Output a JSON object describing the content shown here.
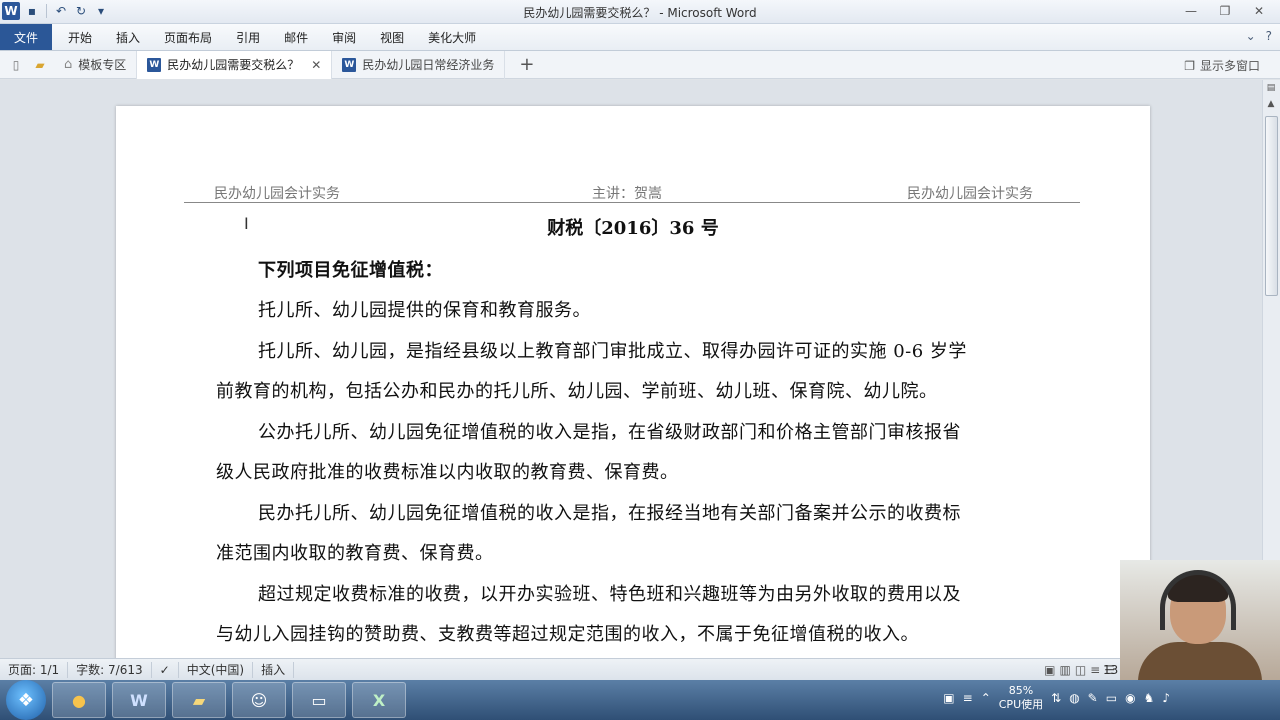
{
  "window": {
    "title": "民办幼儿园需要交税么？ - Microsoft Word",
    "controls": [
      "—",
      "❐",
      "✕"
    ]
  },
  "quick_access": {
    "logo": "W",
    "icons": [
      "save-icon",
      "undo-icon",
      "redo-icon",
      "customize-icon"
    ]
  },
  "ribbon": {
    "tabs": [
      "文件",
      "开始",
      "插入",
      "页面布局",
      "引用",
      "邮件",
      "审阅",
      "视图",
      "美化大师"
    ],
    "right_icons": [
      "chevron-down-icon",
      "help-icon"
    ]
  },
  "doc_tabs": {
    "home_label": "模板专区",
    "tabs": [
      "民办幼儿园需要交税么？",
      "民办幼儿园日常经济业务"
    ],
    "multi_window_label": "显示多窗口",
    "plus": "+"
  },
  "document": {
    "header_left": "民办幼儿园会计实务",
    "header_center": "主讲：贺嵩",
    "header_right": "民办幼儿园会计实务",
    "title": "财税〔2016〕36 号",
    "paragraphs": [
      "下列项目免征增值税：",
      "托儿所、幼儿园提供的保育和教育服务。",
      "托儿所、幼儿园，是指经县级以上教育部门审批成立、取得办园许可证的实施 0-6 岁学",
      "前教育的机构，包括公办和民办的托儿所、幼儿园、学前班、幼儿班、保育院、幼儿院。",
      "公办托儿所、幼儿园免征增值税的收入是指，在省级财政部门和价格主管部门审核报省",
      "级人民政府批准的收费标准以内收取的教育费、保育费。",
      "民办托儿所、幼儿园免征增值税的收入是指，在报经当地有关部门备案并公示的收费标",
      "准范围内收取的教育费、保育费。",
      "超过规定收费标准的收费，以开办实验班、特色班和兴趣班等为由另外收取的费用以及",
      "与幼儿入园挂钩的赞助费、支教费等超过规定范围的收入，不属于免征增值税的收入。"
    ]
  },
  "status_bar": {
    "page": "页面: 1/1",
    "words": "字数: 7/613",
    "language": "中文(中国)",
    "mode": "插入",
    "zoom": "13"
  },
  "taskbar": {
    "apps": [
      "W",
      "X"
    ],
    "cpu_percent": "85%",
    "cpu_label": "CPU使用"
  }
}
